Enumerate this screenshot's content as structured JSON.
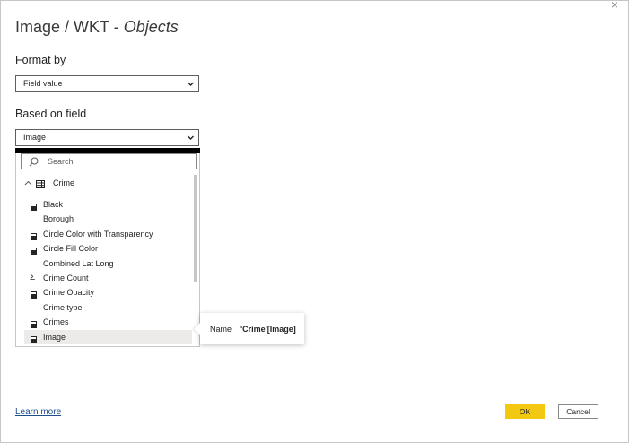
{
  "dialog": {
    "title_main": "Image / WKT - ",
    "title_italic": "Objects",
    "close_glyph": "×"
  },
  "format_by": {
    "label": "Format by",
    "value": "Field value"
  },
  "based_on_field": {
    "label": "Based on field",
    "value": "Image"
  },
  "dropdown": {
    "search_placeholder": "Search",
    "table_name": "Crime",
    "items": [
      {
        "label": "Black",
        "icon": "calc-icon"
      },
      {
        "label": "Borough",
        "icon": ""
      },
      {
        "label": "Circle Color with Transparency",
        "icon": "calc-icon"
      },
      {
        "label": "Circle Fill Color",
        "icon": "calc-icon"
      },
      {
        "label": "Combined Lat Long",
        "icon": ""
      },
      {
        "label": "Crime Count",
        "icon": "sigma-icon"
      },
      {
        "label": "Crime Opacity",
        "icon": "calc-icon"
      },
      {
        "label": "Crime type",
        "icon": ""
      },
      {
        "label": "Crimes",
        "icon": "calc-icon"
      },
      {
        "label": "Image",
        "icon": "calc-icon",
        "selected": true
      }
    ]
  },
  "tooltip": {
    "key": "Name",
    "value": "'Crime'[Image]"
  },
  "footer": {
    "learn_more": "Learn more",
    "ok": "OK",
    "cancel": "Cancel"
  },
  "colors": {
    "ok_button": "#f2c811",
    "selected_item": "#edebe9",
    "link": "#1f4e8c"
  }
}
